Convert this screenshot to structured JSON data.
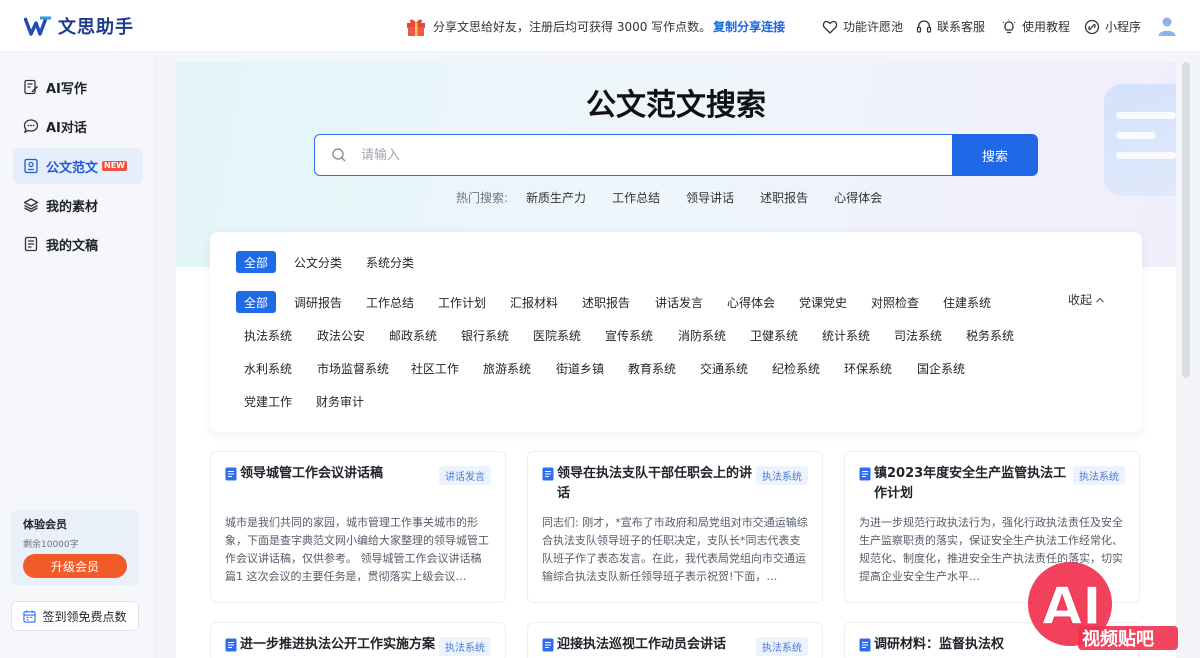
{
  "header": {
    "logo_text": "文思助手",
    "promo_text": "分享文思给好友，注册后均可获得 3000 写作点数。",
    "promo_link": "复制分享连接",
    "nav": [
      {
        "label": "功能许愿池",
        "icon": "heart-icon"
      },
      {
        "label": "联系客服",
        "icon": "headset-icon"
      },
      {
        "label": "使用教程",
        "icon": "lightbulb-icon"
      },
      {
        "label": "小程序",
        "icon": "mini-program-icon"
      }
    ]
  },
  "sidebar": {
    "items": [
      {
        "label": "AI写作",
        "icon": "edit-doc-icon"
      },
      {
        "label": "AI对话",
        "icon": "chat-icon"
      },
      {
        "label": "公文范文",
        "icon": "template-icon",
        "badge": "NEW",
        "active": true
      },
      {
        "label": "我的素材",
        "icon": "layers-icon"
      },
      {
        "label": "我的文稿",
        "icon": "document-icon"
      }
    ],
    "member_title": "体验会员",
    "member_sub": "剩余10000字",
    "upgrade_label": "升级会员",
    "checkin_label": "签到领免费点数"
  },
  "main": {
    "title": "公文范文搜索",
    "search_placeholder": "请输入",
    "search_button": "搜索",
    "hot_label": "热门搜索:",
    "hot_items": [
      "新质生产力",
      "工作总结",
      "领导讲话",
      "述职报告",
      "心得体会"
    ],
    "top_tabs": [
      "全部",
      "公文分类",
      "系统分类"
    ],
    "collapse_label": "收起",
    "categories": [
      [
        "全部",
        "调研报告",
        "工作总结",
        "工作计划",
        "汇报材料",
        "述职报告",
        "讲话发言",
        "心得体会",
        "党课党史",
        "对照检查",
        "住建系统"
      ],
      [
        "执法系统",
        "政法公安",
        "邮政系统",
        "银行系统",
        "医院系统",
        "宣传系统",
        "消防系统",
        "卫健系统",
        "统计系统",
        "司法系统",
        "税务系统"
      ],
      [
        "水利系统",
        "市场监督系统",
        "社区工作",
        "旅游系统",
        "街道乡镇",
        "教育系统",
        "交通系统",
        "纪检系统",
        "环保系统",
        "国企系统"
      ],
      [
        "党建工作",
        "财务审计"
      ]
    ],
    "cards": [
      {
        "title": "领导城管工作会议讲话稿",
        "tag": "讲话发言",
        "body": "城市是我们共同的家园，城市管理工作事关城市的形象，下面是查字典范文网小编给大家整理的领导城管工作会议讲话稿，仅供参考。 领导城管工作会议讲话稿篇1 这次会议的主要任务是，贯彻落实上级会议…"
      },
      {
        "title": "领导在执法支队干部任职会上的讲话",
        "tag": "执法系统",
        "body": "同志们: 刚才，*宣布了市政府和局党组对市交通运输综合执法支队领导班子的任职决定，支队长*同志代表支队班子作了表态发言。在此，我代表局党组向市交通运输综合执法支队新任领导班子表示祝贺!下面，…"
      },
      {
        "title": "镇2023年度安全生产监管执法工作计划",
        "tag": "执法系统",
        "body": "为进一步规范行政执法行为，强化行政执法责任及安全生产监察职责的落实，保证安全生产执法工作经常化、规范化、制度化，推进安全生产执法责任的落实，切实提高企业安全生产水平…"
      },
      {
        "title": "进一步推进执法公开工作实施方案",
        "tag": "执法系统",
        "body": ""
      },
      {
        "title": "迎接执法巡视工作动员会讲话",
        "tag": "执法系统",
        "body": ""
      },
      {
        "title": "调研材料：监督执法权",
        "tag": "",
        "body": ""
      }
    ]
  },
  "watermark_text": "AI 视频贴吧"
}
